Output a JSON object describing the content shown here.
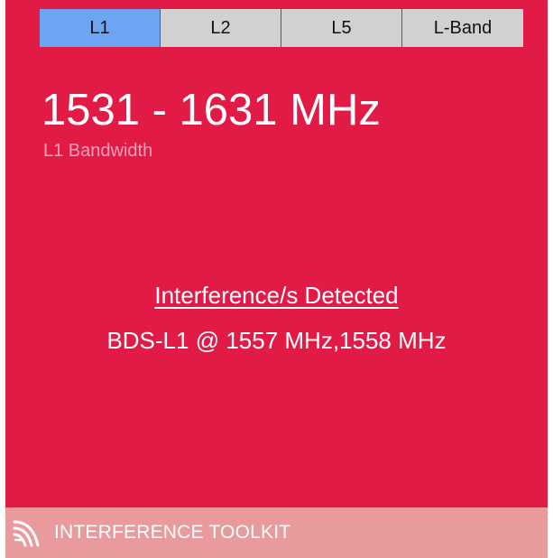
{
  "tabs": [
    {
      "label": "L1",
      "active": true
    },
    {
      "label": "L2",
      "active": false
    },
    {
      "label": "L5",
      "active": false
    },
    {
      "label": "L-Band",
      "active": false
    }
  ],
  "frequency": {
    "range": "1531 - 1631 MHz",
    "caption": "L1 Bandwidth"
  },
  "detection": {
    "title": "Interference/s Detected",
    "detail": "BDS-L1 @ 1557 MHz,1558 MHz"
  },
  "footer": {
    "icon": "signal-waves-icon",
    "label": "INTERFERENCE TOOLKIT"
  },
  "colors": {
    "panel_background": "#e21b46",
    "active_tab": "#6ea5f2",
    "inactive_tab": "#d1d1d1",
    "footer_background": "#e99a9c"
  }
}
